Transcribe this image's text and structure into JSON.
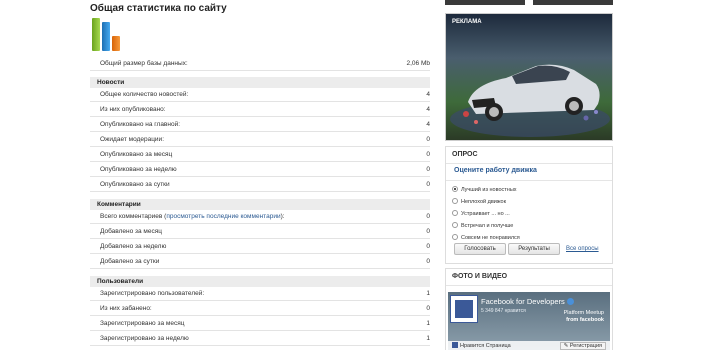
{
  "title": "Общая статистика по сайту",
  "db_size": {
    "label": "Общий размер базы данных:",
    "value": "2,06 Mb"
  },
  "chart_colors": [
    "#8fc43a",
    "#2c8ed6",
    "#f07a18"
  ],
  "news": {
    "heading": "Новости",
    "rows": [
      {
        "label": "Общее количество новостей:",
        "value": "4"
      },
      {
        "label": "Из них опубликовано:",
        "value": "4"
      },
      {
        "label": "Опубликовано на главной:",
        "value": "4"
      },
      {
        "label": "Ожидает модерации:",
        "value": "0"
      },
      {
        "label": "Опубликовано за месяц",
        "value": "0"
      },
      {
        "label": "Опубликовано за неделю",
        "value": "0"
      },
      {
        "label": "Опубликовано за сутки",
        "value": "0"
      }
    ]
  },
  "comments": {
    "heading": "Комментарии",
    "total_label": "Всего комментариев (",
    "total_link": "просмотреть последние комментарии",
    "total_suffix": "):",
    "total_value": "0",
    "rows": [
      {
        "label": "Добавлено за месяц",
        "value": "0"
      },
      {
        "label": "Добавлено за неделю",
        "value": "0"
      },
      {
        "label": "Добавлено за сутки",
        "value": "0"
      }
    ]
  },
  "users": {
    "heading": "Пользователи",
    "rows": [
      {
        "label": "Зарегистрировано пользователей:",
        "value": "1"
      },
      {
        "label": "Из них забанено:",
        "value": "0"
      },
      {
        "label": "Зарегистрировано за месяц",
        "value": "1"
      },
      {
        "label": "Зарегистрировано за неделю",
        "value": "1"
      }
    ]
  },
  "ad": {
    "label": "РЕКЛАМА"
  },
  "poll": {
    "heading": "ОПРОС",
    "question": "Оцените работу движка",
    "options": [
      "Лучший из новостных",
      "Неплохой движок",
      "Устраивает ... но ...",
      "Встречал и получше",
      "Совсем не понравился"
    ],
    "vote_label": "Голосовать",
    "results_label": "Результаты",
    "all_polls_label": "Все опросы"
  },
  "media": {
    "heading": "ФОТО И ВИДЕО",
    "fb_name": "Facebook for Developers",
    "fb_likes": "5 349 847 нравится",
    "fb_promo_line1": "Platform Meetup",
    "fb_promo_line2": "from facebook",
    "like_label": "Нравится Страница",
    "register_label": "Регистрация"
  }
}
